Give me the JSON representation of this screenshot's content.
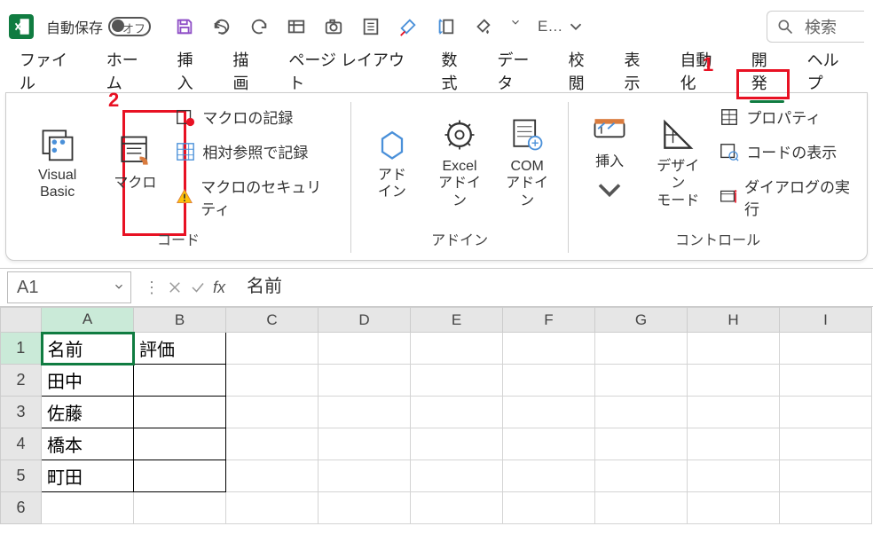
{
  "titlebar": {
    "autosave_label": "自動保存",
    "autosave_state": "オフ"
  },
  "search": {
    "placeholder": "検索"
  },
  "tabs": {
    "file": "ファイル",
    "home": "ホーム",
    "insert": "挿入",
    "draw": "描画",
    "pagelayout": "ページ レイアウト",
    "formulas": "数式",
    "data": "データ",
    "review": "校閲",
    "view": "表示",
    "automate": "自動化",
    "developer": "開発",
    "help": "ヘルプ"
  },
  "ribbon": {
    "code_group": {
      "vb": "Visual Basic",
      "macros": "マクロ",
      "record_macro": "マクロの記録",
      "relative_ref": "相対参照で記録",
      "macro_security": "マクロのセキュリティ",
      "label": "コード"
    },
    "addins_group": {
      "addins": "アド\nイン",
      "excel_addins": "Excel\nアドイン",
      "com_addins": "COM\nアドイン",
      "label": "アドイン"
    },
    "controls_group": {
      "insert": "挿入",
      "design_mode": "デザイン\nモード",
      "properties": "プロパティ",
      "view_code": "コードの表示",
      "run_dialog": "ダイアログの実行",
      "label": "コントロール"
    }
  },
  "formula_bar": {
    "namebox": "A1",
    "value": "名前"
  },
  "grid": {
    "cols": [
      "A",
      "B",
      "C",
      "D",
      "E",
      "F",
      "G",
      "H",
      "I"
    ],
    "rows": [
      {
        "hdr": "1",
        "cells": [
          "名前",
          "評価",
          "",
          "",
          "",
          "",
          "",
          "",
          ""
        ]
      },
      {
        "hdr": "2",
        "cells": [
          "田中",
          "",
          "",
          "",
          "",
          "",
          "",
          "",
          ""
        ]
      },
      {
        "hdr": "3",
        "cells": [
          "佐藤",
          "",
          "",
          "",
          "",
          "",
          "",
          "",
          ""
        ]
      },
      {
        "hdr": "4",
        "cells": [
          "橋本",
          "",
          "",
          "",
          "",
          "",
          "",
          "",
          ""
        ]
      },
      {
        "hdr": "5",
        "cells": [
          "町田",
          "",
          "",
          "",
          "",
          "",
          "",
          "",
          ""
        ]
      },
      {
        "hdr": "6",
        "cells": [
          "",
          "",
          "",
          "",
          "",
          "",
          "",
          "",
          ""
        ]
      }
    ]
  },
  "annotations": {
    "n1": "1",
    "n2": "2"
  }
}
